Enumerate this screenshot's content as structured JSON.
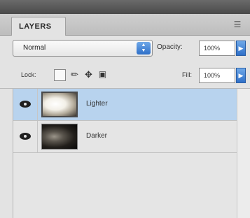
{
  "panel": {
    "tab_label": "LAYERS",
    "menu_icon": "panel-menu-icon"
  },
  "blend": {
    "mode": "Normal",
    "opacity_label": "Opacity:",
    "opacity_value": "100%"
  },
  "lock": {
    "label": "Lock:",
    "icons": [
      "lock-transparent-icon",
      "lock-image-icon",
      "lock-position-icon",
      "lock-all-icon"
    ],
    "fill_label": "Fill:",
    "fill_value": "100%"
  },
  "layers": [
    {
      "name": "Lighter",
      "visible": true,
      "selected": true
    },
    {
      "name": "Darker",
      "visible": true,
      "selected": false
    }
  ],
  "colors": {
    "selection": "#b8d3ee",
    "accent": "#2e6fc8"
  }
}
